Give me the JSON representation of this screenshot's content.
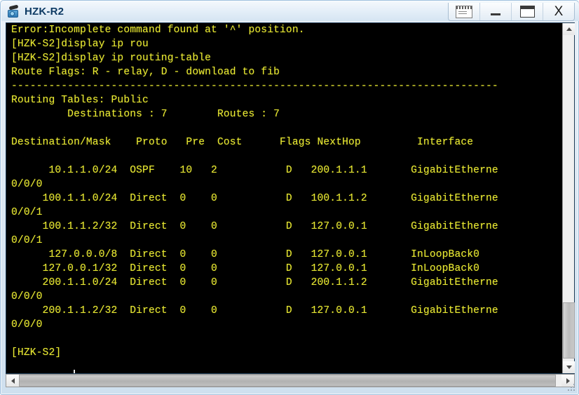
{
  "window": {
    "title": "HZK-R2",
    "icon": "camera-icon",
    "buttons": [
      {
        "name": "window-menu-button",
        "label": "menu"
      },
      {
        "name": "minimize-button",
        "label": "—"
      },
      {
        "name": "maximize-button",
        "label": "maximize"
      },
      {
        "name": "close-button",
        "label": "X"
      }
    ]
  },
  "terminal": {
    "foreground_color": "#e8e832",
    "background_color": "#000000",
    "prompt": "[HZK-S2]",
    "cursor_visible": true,
    "lines": [
      "Error:Incomplete command found at '^' position.",
      "[HZK-S2]display ip rou",
      "[HZK-S2]display ip routing-table",
      "Route Flags: R - relay, D - download to fib",
      "------------------------------------------------------------------------------",
      "Routing Tables: Public",
      "         Destinations : 7        Routes : 7",
      "",
      "Destination/Mask    Proto   Pre  Cost      Flags NextHop         Interface",
      "",
      "      10.1.1.0/24  OSPF    10   2           D   200.1.1.1       GigabitEtherne",
      "0/0/0",
      "     100.1.1.0/24  Direct  0    0           D   100.1.1.2       GigabitEtherne",
      "0/0/1",
      "     100.1.1.2/32  Direct  0    0           D   127.0.0.1       GigabitEtherne",
      "0/0/1",
      "      127.0.0.0/8  Direct  0    0           D   127.0.0.1       InLoopBack0",
      "     127.0.0.1/32  Direct  0    0           D   127.0.0.1       InLoopBack0",
      "     200.1.1.0/24  Direct  0    0           D   200.1.1.2       GigabitEtherne",
      "0/0/0",
      "     200.1.1.2/32  Direct  0    0           D   127.0.0.1       GigabitEtherne",
      "0/0/0",
      "",
      "[HZK-S2]"
    ],
    "command_output": {
      "error_message": "Error:Incomplete command found at '^' position.",
      "commands": [
        "display ip rou",
        "display ip routing-table"
      ],
      "route_flags_legend": "Route Flags: R - relay, D - download to fib",
      "routing_table_name": "Routing Tables: Public",
      "destinations": "7",
      "routes": "7",
      "columns": [
        "Destination/Mask",
        "Proto",
        "Pre",
        "Cost",
        "Flags",
        "NextHop",
        "Interface"
      ],
      "rows": [
        {
          "destination": "10.1.1.0/24",
          "proto": "OSPF",
          "pre": "10",
          "cost": "2",
          "flags": "D",
          "nexthop": "200.1.1.1",
          "interface": "GigabitEthernet0/0/0"
        },
        {
          "destination": "100.1.1.0/24",
          "proto": "Direct",
          "pre": "0",
          "cost": "0",
          "flags": "D",
          "nexthop": "100.1.1.2",
          "interface": "GigabitEthernet0/0/1"
        },
        {
          "destination": "100.1.1.2/32",
          "proto": "Direct",
          "pre": "0",
          "cost": "0",
          "flags": "D",
          "nexthop": "127.0.0.1",
          "interface": "GigabitEthernet0/0/1"
        },
        {
          "destination": "127.0.0.0/8",
          "proto": "Direct",
          "pre": "0",
          "cost": "0",
          "flags": "D",
          "nexthop": "127.0.0.1",
          "interface": "InLoopBack0"
        },
        {
          "destination": "127.0.0.1/32",
          "proto": "Direct",
          "pre": "0",
          "cost": "0",
          "flags": "D",
          "nexthop": "127.0.0.1",
          "interface": "InLoopBack0"
        },
        {
          "destination": "200.1.1.0/24",
          "proto": "Direct",
          "pre": "0",
          "cost": "0",
          "flags": "D",
          "nexthop": "200.1.1.2",
          "interface": "GigabitEthernet0/0/0"
        },
        {
          "destination": "200.1.1.2/32",
          "proto": "Direct",
          "pre": "0",
          "cost": "0",
          "flags": "D",
          "nexthop": "127.0.0.1",
          "interface": "GigabitEthernet0/0/0"
        }
      ]
    }
  },
  "scrollbars": {
    "vertical": {
      "up_arrow": "▲",
      "down_arrow": "▼"
    },
    "horizontal": {
      "left_arrow": "◀",
      "right_arrow": "▶"
    }
  }
}
